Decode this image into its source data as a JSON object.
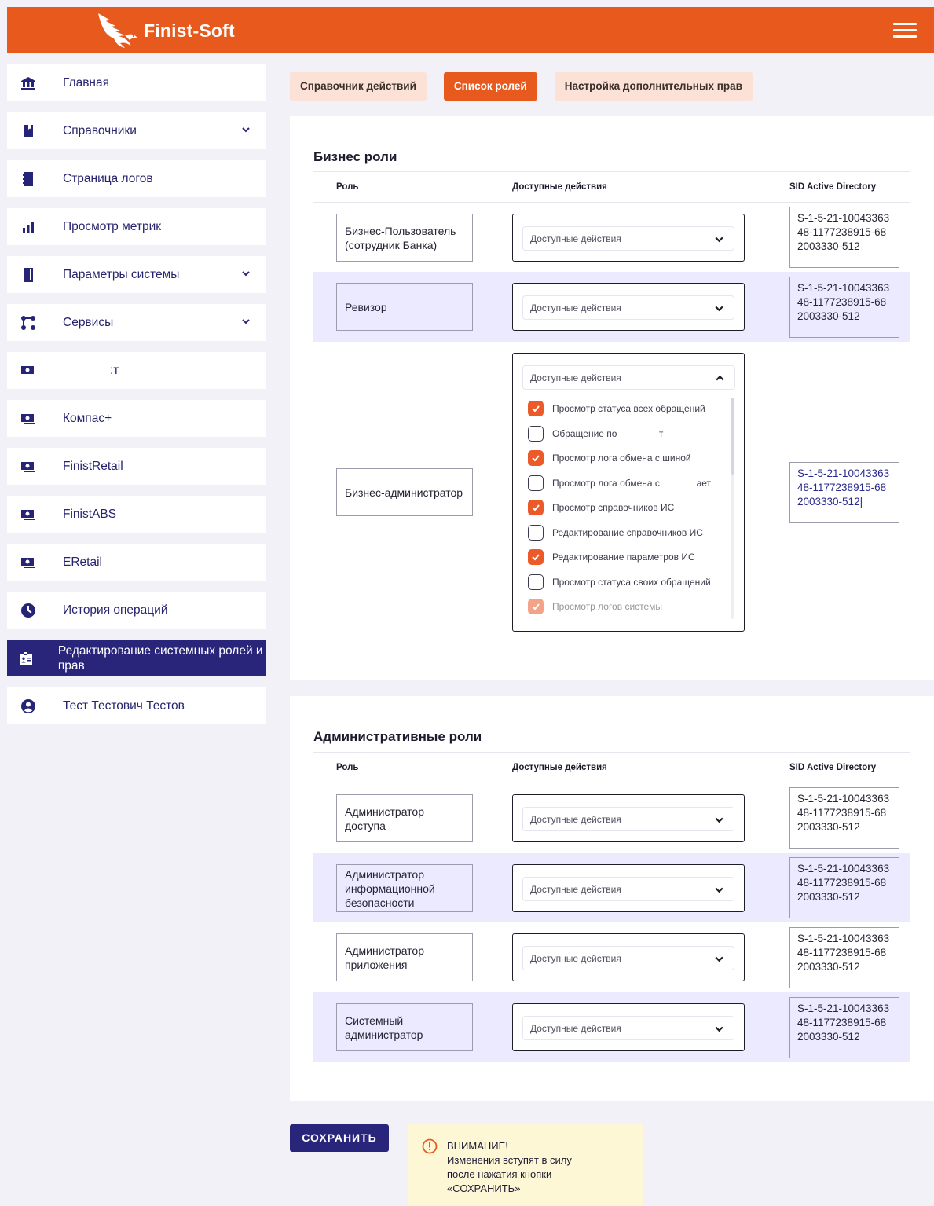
{
  "header": {
    "brand": "Finist-Soft",
    "brand_color": "#e8591d",
    "menu_icon": "hamburger-icon"
  },
  "sidebar": {
    "items": [
      {
        "label": "Главная",
        "icon": "bank-icon",
        "expandable": false
      },
      {
        "label": "Справочники",
        "icon": "book-icon",
        "expandable": true
      },
      {
        "label": "Страница логов",
        "icon": "log-book-icon",
        "expandable": false
      },
      {
        "label": "Просмотр метрик",
        "icon": "bar-chart-icon",
        "expandable": false
      },
      {
        "label": "Параметры системы",
        "icon": "document-icon",
        "expandable": true
      },
      {
        "label": "Сервисы",
        "icon": "nodes-icon",
        "expandable": true
      },
      {
        "label": ":т",
        "icon": "money-icon",
        "expandable": false
      },
      {
        "label": "Компас+",
        "icon": "money-icon",
        "expandable": false
      },
      {
        "label": "FinistRetail",
        "icon": "money-icon",
        "expandable": false
      },
      {
        "label": "FinistABS",
        "icon": "money-icon",
        "expandable": false
      },
      {
        "label": "ERetail",
        "icon": "money-icon",
        "expandable": false
      },
      {
        "label": "История операций",
        "icon": "clock-icon",
        "expandable": false
      },
      {
        "label": "Редактирование системных ролей и прав",
        "icon": "id-card-icon",
        "expandable": false,
        "active": true
      },
      {
        "label": "Тест Тестович Тестов",
        "icon": "user-icon",
        "expandable": false
      }
    ]
  },
  "tabs": [
    {
      "label": "Справочник действий",
      "active": false
    },
    {
      "label": "Список ролей",
      "active": true
    },
    {
      "label": "Настройка дополнительных прав",
      "active": false
    }
  ],
  "columns": {
    "role": "Роль",
    "actions": "Доступные действия",
    "sid": "SID Active Directory"
  },
  "select_placeholder": "Доступные действия",
  "business": {
    "title": "Бизнес роли",
    "rows": [
      {
        "role": "Бизнес-Пользователь (сотрудник Банка)",
        "sid": "S-1-5-21-1004336348-1177238915-682003330-512"
      },
      {
        "role": "Ревизор",
        "sid": "S-1-5-21-1004336348-1177238915-682003330-512"
      },
      {
        "role": "Бизнес-администратор",
        "sid": "S-1-5-21-1004336348-1177238915-682003330-512|"
      }
    ],
    "dropdown_options": [
      {
        "label": "Просмотр статуса всех обращений",
        "checked": true
      },
      {
        "label": "Обращение по                т",
        "checked": false
      },
      {
        "label": "Просмотр лога обмена с шиной",
        "checked": true
      },
      {
        "label": "Просмотр лога обмена с              ает",
        "checked": false
      },
      {
        "label": "Просмотр справочников ИС",
        "checked": true
      },
      {
        "label": "Редактирование справочников ИС",
        "checked": false
      },
      {
        "label": "Редактирование параметров ИС",
        "checked": true
      },
      {
        "label": "Просмотр статуса своих обращений",
        "checked": false
      },
      {
        "label": "Просмотр логов системы",
        "checked": true
      }
    ]
  },
  "admin": {
    "title": "Административные роли",
    "rows": [
      {
        "role": "Администратор доступа",
        "sid": "S-1-5-21-1004336348-1177238915-682003330-512"
      },
      {
        "role": "Администратор информационной безопасности",
        "sid": "S-1-5-21-1004336348-1177238915-682003330-512"
      },
      {
        "role": "Администратор приложения",
        "sid": "S-1-5-21-1004336348-1177238915-682003330-512"
      },
      {
        "role": "Системный администратор",
        "sid": "S-1-5-21-1004336348-1177238915-682003330-512"
      }
    ]
  },
  "save_label": "СОХРАНИТЬ",
  "warning": {
    "icon": "warning-circle-icon",
    "lines": [
      "ВНИМАНИЕ!",
      "Изменения вступят в силу",
      "после нажатия кнопки",
      "«СОХРАНИТЬ»"
    ]
  }
}
